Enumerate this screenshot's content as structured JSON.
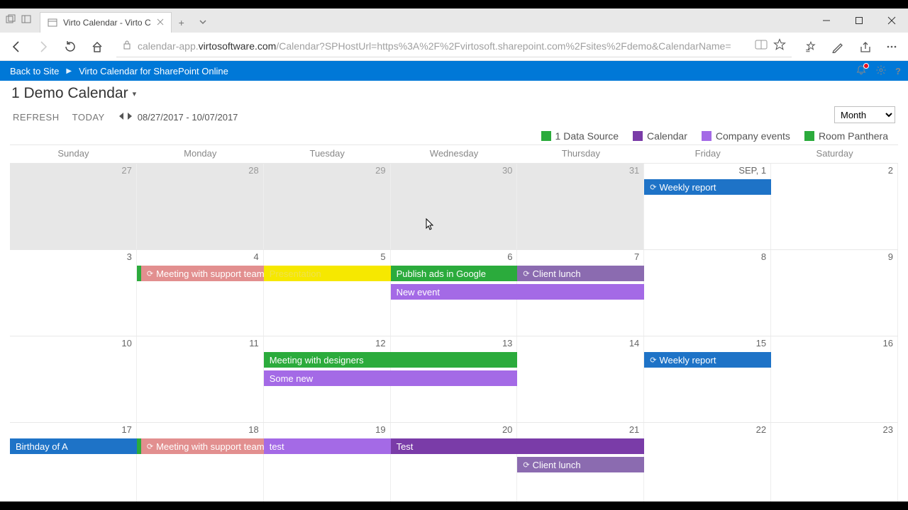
{
  "browser": {
    "tab_title": "Virto Calendar - Virto C",
    "url_full": "calendar-app.virtosoftware.com/Calendar?SPHostUrl=https%3A%2F%2Fvirtosoft.sharepoint.com%2Fsites%2Fdemo&CalendarName=",
    "url_prefix": "calendar-app.",
    "url_host": "virtosoftware.com",
    "url_path": "/Calendar?SPHostUrl=https%3A%2F%2Fvirtosoft.sharepoint.com%2Fsites%2Fdemo&CalendarName="
  },
  "spbar": {
    "back": "Back to Site",
    "title": "Virto Calendar for SharePoint Online"
  },
  "page": {
    "title": "1 Demo Calendar",
    "refresh": "REFRESH",
    "today": "TODAY",
    "range": "08/27/2017 - 10/07/2017",
    "view": "Month"
  },
  "legend": [
    {
      "label": "1 Data Source",
      "color": "#2bab3c"
    },
    {
      "label": "Calendar",
      "color": "#7a3ca8"
    },
    {
      "label": "Company events",
      "color": "#a46ae6"
    },
    {
      "label": "Room Panthera",
      "color": "#2bab3c"
    }
  ],
  "days": [
    "Sunday",
    "Monday",
    "Tuesday",
    "Wednesday",
    "Thursday",
    "Friday",
    "Saturday"
  ],
  "grid": [
    [
      {
        "n": "27",
        "dim": true
      },
      {
        "n": "28",
        "dim": true
      },
      {
        "n": "29",
        "dim": true
      },
      {
        "n": "30",
        "dim": true
      },
      {
        "n": "31",
        "dim": true
      },
      {
        "n": "SEP, 1"
      },
      {
        "n": "2"
      }
    ],
    [
      {
        "n": "3"
      },
      {
        "n": "4"
      },
      {
        "n": "5"
      },
      {
        "n": "6"
      },
      {
        "n": "7"
      },
      {
        "n": "8"
      },
      {
        "n": "9"
      }
    ],
    [
      {
        "n": "10"
      },
      {
        "n": "11"
      },
      {
        "n": "12"
      },
      {
        "n": "13"
      },
      {
        "n": "14"
      },
      {
        "n": "15"
      },
      {
        "n": "16"
      }
    ],
    [
      {
        "n": "17"
      },
      {
        "n": "18"
      },
      {
        "n": "19"
      },
      {
        "n": "20"
      },
      {
        "n": "21"
      },
      {
        "n": "22"
      },
      {
        "n": "23"
      }
    ]
  ],
  "events": {
    "w0": [
      {
        "label": "Weekly report",
        "row": 0,
        "startCol": 5,
        "endCol": 5,
        "color": "#1e73c7",
        "recur": true
      }
    ],
    "w1": [
      {
        "label": "Meeting with support team",
        "row": 0,
        "startCol": 1,
        "endCol": 1,
        "color": "#e28f8f",
        "leftStripe": "#2bab3c",
        "recur": true
      },
      {
        "label": "Presentation",
        "row": 0,
        "startCol": 2,
        "endCol": 2,
        "color": "#f6e800",
        "textColor": "#f0e24a"
      },
      {
        "label": "Publish ads in Google",
        "row": 0,
        "startCol": 3,
        "endCol": 3,
        "color": "#2bab3c"
      },
      {
        "label": "Client lunch",
        "row": 0,
        "startCol": 4,
        "endCol": 4,
        "color": "#8b6bb0",
        "recur": true
      },
      {
        "label": "New event",
        "row": 1,
        "startCol": 3,
        "endCol": 4,
        "color": "#a46ae6"
      }
    ],
    "w2": [
      {
        "label": "Meeting with designers",
        "row": 0,
        "startCol": 2,
        "endCol": 3,
        "color": "#2bab3c"
      },
      {
        "label": "Some new",
        "row": 1,
        "startCol": 2,
        "endCol": 3,
        "color": "#a46ae6"
      },
      {
        "label": "Weekly report",
        "row": 0,
        "startCol": 5,
        "endCol": 5,
        "color": "#1e73c7",
        "recur": true
      }
    ],
    "w3": [
      {
        "label": "Birthday of A",
        "row": 0,
        "startCol": 0,
        "endCol": 0,
        "color": "#1e73c7"
      },
      {
        "label": "Meeting with support team",
        "row": 0,
        "startCol": 1,
        "endCol": 1,
        "color": "#e28f8f",
        "leftStripe": "#2bab3c",
        "recur": true
      },
      {
        "label": "test",
        "row": 0,
        "startCol": 2,
        "endCol": 2,
        "color": "#a46ae6"
      },
      {
        "label": "Test",
        "row": 0,
        "startCol": 3,
        "endCol": 4,
        "color": "#7a3ca8"
      },
      {
        "label": "Client lunch",
        "row": 1,
        "startCol": 4,
        "endCol": 4,
        "color": "#8b6bb0",
        "recur": true
      }
    ]
  },
  "colors": {
    "accent": "#0078d7"
  }
}
